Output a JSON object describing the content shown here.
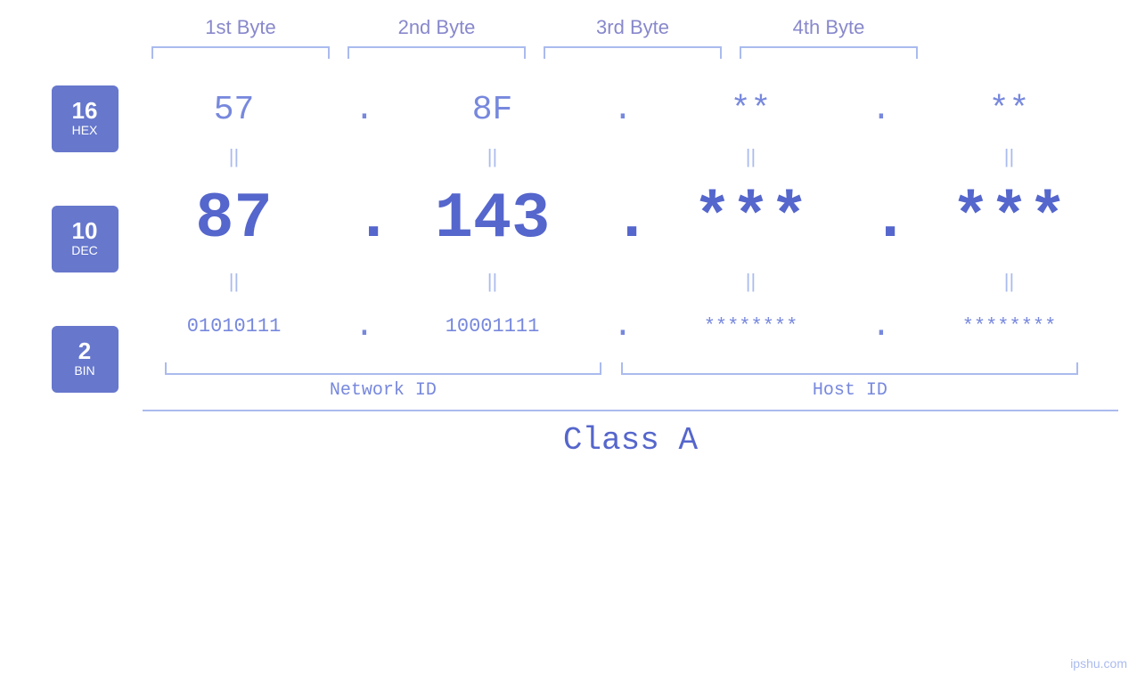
{
  "headers": {
    "col1": "1st Byte",
    "col2": "2nd Byte",
    "col3": "3rd Byte",
    "col4": "4th Byte"
  },
  "badges": {
    "hex": {
      "num": "16",
      "label": "HEX"
    },
    "dec": {
      "num": "10",
      "label": "DEC"
    },
    "bin": {
      "num": "2",
      "label": "BIN"
    }
  },
  "hex_row": {
    "b1": "57",
    "b2": "8F",
    "b3": "**",
    "b4": "**",
    "dots": [
      ".",
      ".",
      ".",
      "."
    ]
  },
  "dec_row": {
    "b1": "87",
    "b2": "143",
    "b3": "***",
    "b4": "***",
    "dots": [
      ".",
      ".",
      ".",
      "."
    ]
  },
  "bin_row": {
    "b1": "01010111",
    "b2": "10001111",
    "b3": "********",
    "b4": "********",
    "dots": [
      ".",
      ".",
      ".",
      "."
    ]
  },
  "equals": "||",
  "labels": {
    "network_id": "Network ID",
    "host_id": "Host ID",
    "class": "Class A"
  },
  "watermark": "ipshu.com"
}
